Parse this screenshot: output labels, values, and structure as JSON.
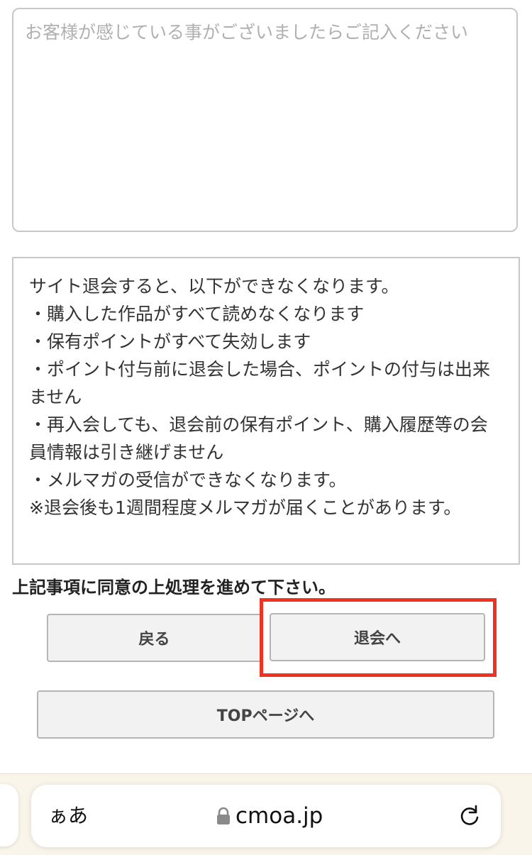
{
  "feedback": {
    "placeholder": "お客様が感じている事がございましたらご記入ください"
  },
  "notice": {
    "lines": [
      "サイト退会すると、以下ができなくなります。",
      "・購入した作品がすべて読めなくなります",
      "・保有ポイントがすべて失効します",
      "・ポイント付与前に退会した場合、ポイントの付与は出来ません",
      "・再入会しても、退会前の保有ポイント、購入履歴等の会員情報は引き継げません",
      "・メルマガの受信ができなくなります。",
      "※退会後も1週間程度メルマガが届くことがあります。"
    ]
  },
  "agree_text": "上記事項に同意の上処理を進めて下さい。",
  "buttons": {
    "back": "戻る",
    "withdraw": "退会へ",
    "top_page": "TOPページへ"
  },
  "highlight_color": "#ee3322",
  "browser": {
    "text_size_label": "ぁあ",
    "url": "cmoa.jp",
    "icons": [
      "lock-icon",
      "reload-icon"
    ]
  }
}
